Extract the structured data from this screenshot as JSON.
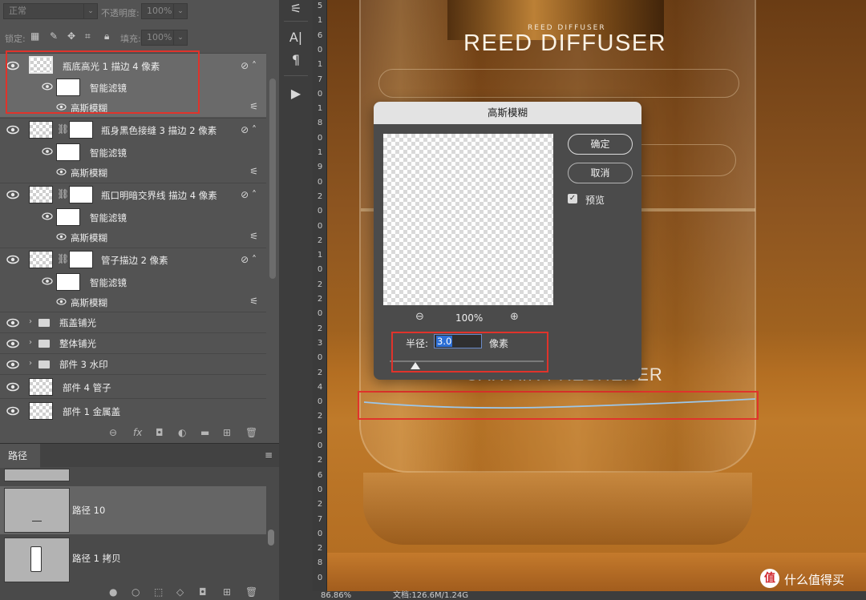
{
  "layers_panel": {
    "blend_mode": "正常",
    "opacity_label": "不透明度:",
    "opacity_value": "100%",
    "lock_label": "锁定:",
    "fill_label": "填充:",
    "fill_value": "100%",
    "layers": [
      {
        "name": "瓶底高光 1 描边 4 像素",
        "filter_group": "智能滤镜",
        "filter": "高斯模糊",
        "selected": true
      },
      {
        "name": "瓶身黑色接缝 3 描边 2 像素",
        "filter_group": "智能滤镜",
        "filter": "高斯模糊"
      },
      {
        "name": "瓶口明暗交界线 描边 4 像素",
        "filter_group": "智能滤镜",
        "filter": "高斯模糊"
      },
      {
        "name": "管子描边 2 像素",
        "filter_group": "智能滤镜",
        "filter": "高斯模糊"
      }
    ],
    "groups": [
      "瓶盖铺光",
      "整体铺光",
      "部件 3 水印"
    ],
    "plain_layers": [
      "部件 4 管子",
      "部件 1 金属盖"
    ]
  },
  "paths_panel": {
    "tab": "路径",
    "paths": [
      "路径 10",
      "路径 1 拷贝"
    ]
  },
  "ruler": {
    "labels": [
      "5",
      "1",
      "6",
      "0",
      "1",
      "7",
      "0",
      "1",
      "8",
      "0",
      "1",
      "9",
      "0",
      "2",
      "0",
      "0",
      "2",
      "1",
      "0",
      "2",
      "2",
      "0",
      "2",
      "3",
      "0",
      "2",
      "4",
      "0",
      "2",
      "5",
      "0",
      "2",
      "6",
      "0",
      "2",
      "7",
      "0",
      "2",
      "8",
      "0"
    ]
  },
  "canvas": {
    "brand_small": "REED DIFFUSER",
    "brand": "REED DIFFUSER",
    "bottom_text": "CAR AIR FRESHENER"
  },
  "status": {
    "zoom": "86.86%",
    "doc": "文档:126.6M/1.24G"
  },
  "dialog": {
    "title": "高斯模糊",
    "ok": "确定",
    "cancel": "取消",
    "preview_label": "预览",
    "zoom_level": "100%",
    "radius_label": "半径:",
    "radius_value": "3.0",
    "radius_unit": "像素",
    "preview_checked": true
  },
  "watermark": "什么值得买",
  "colors": {
    "panel_bg": "#535353",
    "selected_row": "#6a6a6a",
    "highlight": "#e0332b",
    "selection_blue": "#2c6fd6"
  }
}
